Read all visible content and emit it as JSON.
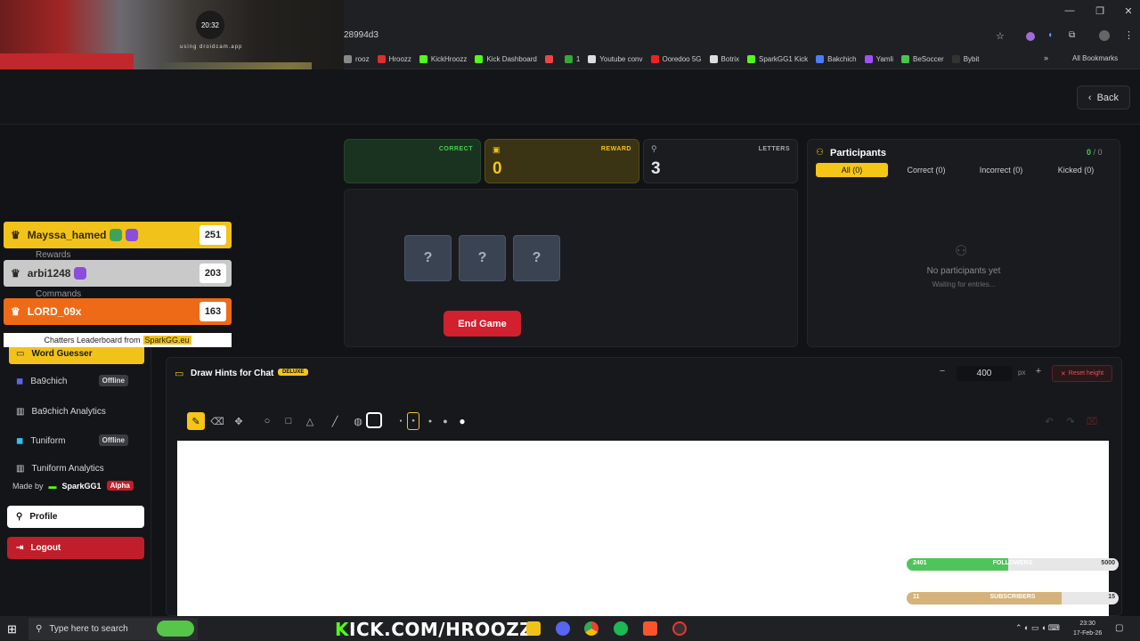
{
  "browser": {
    "url": "28994d3",
    "bookmarks": [
      "rooz",
      "Hroozz",
      "KickHroozz",
      "Kick Dashboard",
      "",
      "1",
      "Youtube conv",
      "Ooredoo 5G",
      "Botrix",
      "SparkGG1 Kick",
      "Bakchich",
      "Yamli",
      "BeSoccer",
      "Bybit"
    ],
    "bookmark_colors": [
      "#888",
      "#e02d2d",
      "#53fc18",
      "#53fc18",
      "#e44",
      "#3a3",
      "#ddd",
      "#e22",
      "#ddd",
      "#53fc18",
      "#4a7cff",
      "#a050ff",
      "#4cc44c",
      "#333"
    ],
    "all_bookmarks": "All Bookmarks"
  },
  "webcam": {
    "clock": "20:32",
    "caption": "using droidcam.app"
  },
  "header": {
    "back_label": "Back"
  },
  "stats": {
    "correct_label": "CORRECT",
    "reward_label": "REWARD",
    "reward_value": "0",
    "letters_label": "LETTERS",
    "letters_value": "3"
  },
  "game": {
    "boxes": [
      "?",
      "?",
      "?"
    ],
    "end_label": "End Game"
  },
  "participants": {
    "title": "Participants",
    "count_current": "0",
    "count_sep": "/",
    "count_total": "0",
    "tabs": [
      "All (0)",
      "Correct (0)",
      "Incorrect (0)",
      "Kicked (0)"
    ],
    "empty_title": "No participants yet",
    "empty_sub": "Waiting for entries..."
  },
  "draw": {
    "title": "Draw Hints for Chat",
    "badge": "DELUXE",
    "height_value": "400",
    "height_unit": "px",
    "reset_label": "Reset height"
  },
  "leaderboard": {
    "rows": [
      {
        "name": "Mayssa_hamed",
        "score": "251"
      },
      {
        "name": "arbi1248",
        "score": "203"
      },
      {
        "name": "LORD_09x",
        "score": "163"
      }
    ],
    "footer_prefix": "Chatters Leaderboard from",
    "footer_brand": "SparkGG.eu",
    "hidden_labels": [
      "Rewards",
      "Commands"
    ]
  },
  "sidebar": {
    "items": [
      {
        "label": "Word Guesser"
      },
      {
        "label": "Ba9chich",
        "status": "Offline"
      },
      {
        "label": "Ba9chich Analytics"
      },
      {
        "label": "Tuniform",
        "status": "Offline"
      },
      {
        "label": "Tuniform Analytics"
      }
    ],
    "made_by": "Made by",
    "made_by_name": "SparkGG1",
    "alpha": "Alpha",
    "profile": "Profile",
    "logout": "Logout"
  },
  "goals": {
    "followers": {
      "current": "2401",
      "label": "FOLLOWERS",
      "target": "5000",
      "progress": 0.48
    },
    "subscribers": {
      "current": "11",
      "label": "SUBSCRIBERS",
      "target": "15",
      "progress": 0.73
    }
  },
  "taskbar": {
    "search_placeholder": "Type here to search",
    "stream_text_prefix": "K",
    "stream_text": "ICK.COM/HROOZZ",
    "time": "23:30",
    "date": "17-Feb-26"
  }
}
